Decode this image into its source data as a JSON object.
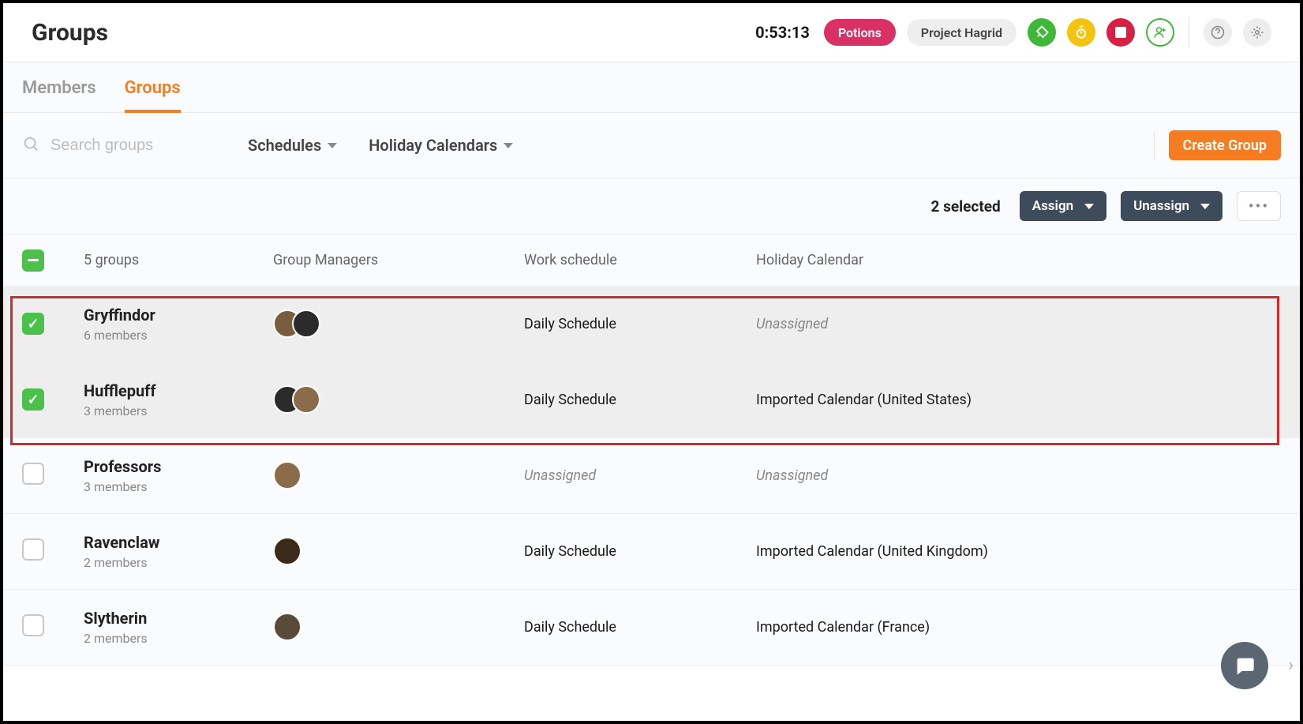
{
  "header": {
    "title": "Groups",
    "timer": "0:53:13",
    "pill_primary": "Potions",
    "pill_secondary": "Project Hagrid"
  },
  "tabs": {
    "members": "Members",
    "groups": "Groups"
  },
  "toolbar": {
    "search_placeholder": "Search groups",
    "filter_schedules": "Schedules",
    "filter_calendars": "Holiday Calendars",
    "create_label": "Create Group"
  },
  "selection": {
    "count_label": "2 selected",
    "assign_label": "Assign",
    "unassign_label": "Unassign"
  },
  "table": {
    "groups_count": "5 groups",
    "col_managers": "Group Managers",
    "col_schedule": "Work schedule",
    "col_calendar": "Holiday Calendar",
    "rows": [
      {
        "name": "Gryffindor",
        "members": "6 members",
        "schedule": "Daily Schedule",
        "calendar": "Unassigned",
        "calendar_italic": true,
        "checked": true,
        "avatars": 2
      },
      {
        "name": "Hufflepuff",
        "members": "3 members",
        "schedule": "Daily Schedule",
        "calendar": "Imported Calendar (United States)",
        "calendar_italic": false,
        "checked": true,
        "avatars": 2
      },
      {
        "name": "Professors",
        "members": "3 members",
        "schedule": "Unassigned",
        "schedule_italic": true,
        "calendar": "Unassigned",
        "calendar_italic": true,
        "checked": false,
        "avatars": 1
      },
      {
        "name": "Ravenclaw",
        "members": "2 members",
        "schedule": "Daily Schedule",
        "calendar": "Imported Calendar (United Kingdom)",
        "calendar_italic": false,
        "checked": false,
        "avatars": 1
      },
      {
        "name": "Slytherin",
        "members": "2 members",
        "schedule": "Daily Schedule",
        "calendar": "Imported Calendar (France)",
        "calendar_italic": false,
        "checked": false,
        "avatars": 1
      }
    ]
  }
}
